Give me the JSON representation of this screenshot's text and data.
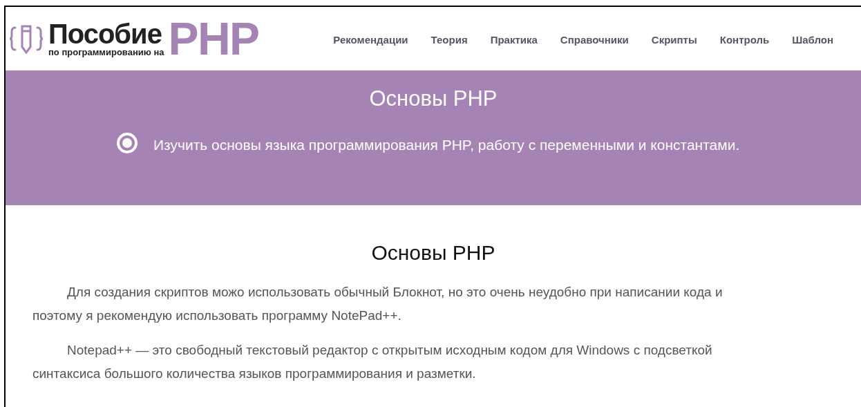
{
  "logo": {
    "title": "Пособие",
    "subtitle": "по программированию на",
    "accent": "PHP"
  },
  "nav": [
    {
      "label": "Рекомендации"
    },
    {
      "label": "Теория"
    },
    {
      "label": "Практика"
    },
    {
      "label": "Справочники"
    },
    {
      "label": "Скрипты"
    },
    {
      "label": "Контроль"
    },
    {
      "label": "Шаблон"
    }
  ],
  "banner": {
    "title": "Основы PHP",
    "goal": "Изучить основы языка программирования PHP, работу с переменными и константами."
  },
  "article": {
    "heading": "Основы PHP",
    "paragraphs": [
      "Для создания скриптов можо использовать обычный Блокнот, но это очень неудобно при написании кода и поэтому я рекомендую использовать программу NotePad++.",
      "Notepad++ — это свободный текстовый редактор с открытым исходным кодом для Windows с подсветкой синтаксиса большого количества языков программирования и разметки."
    ]
  }
}
